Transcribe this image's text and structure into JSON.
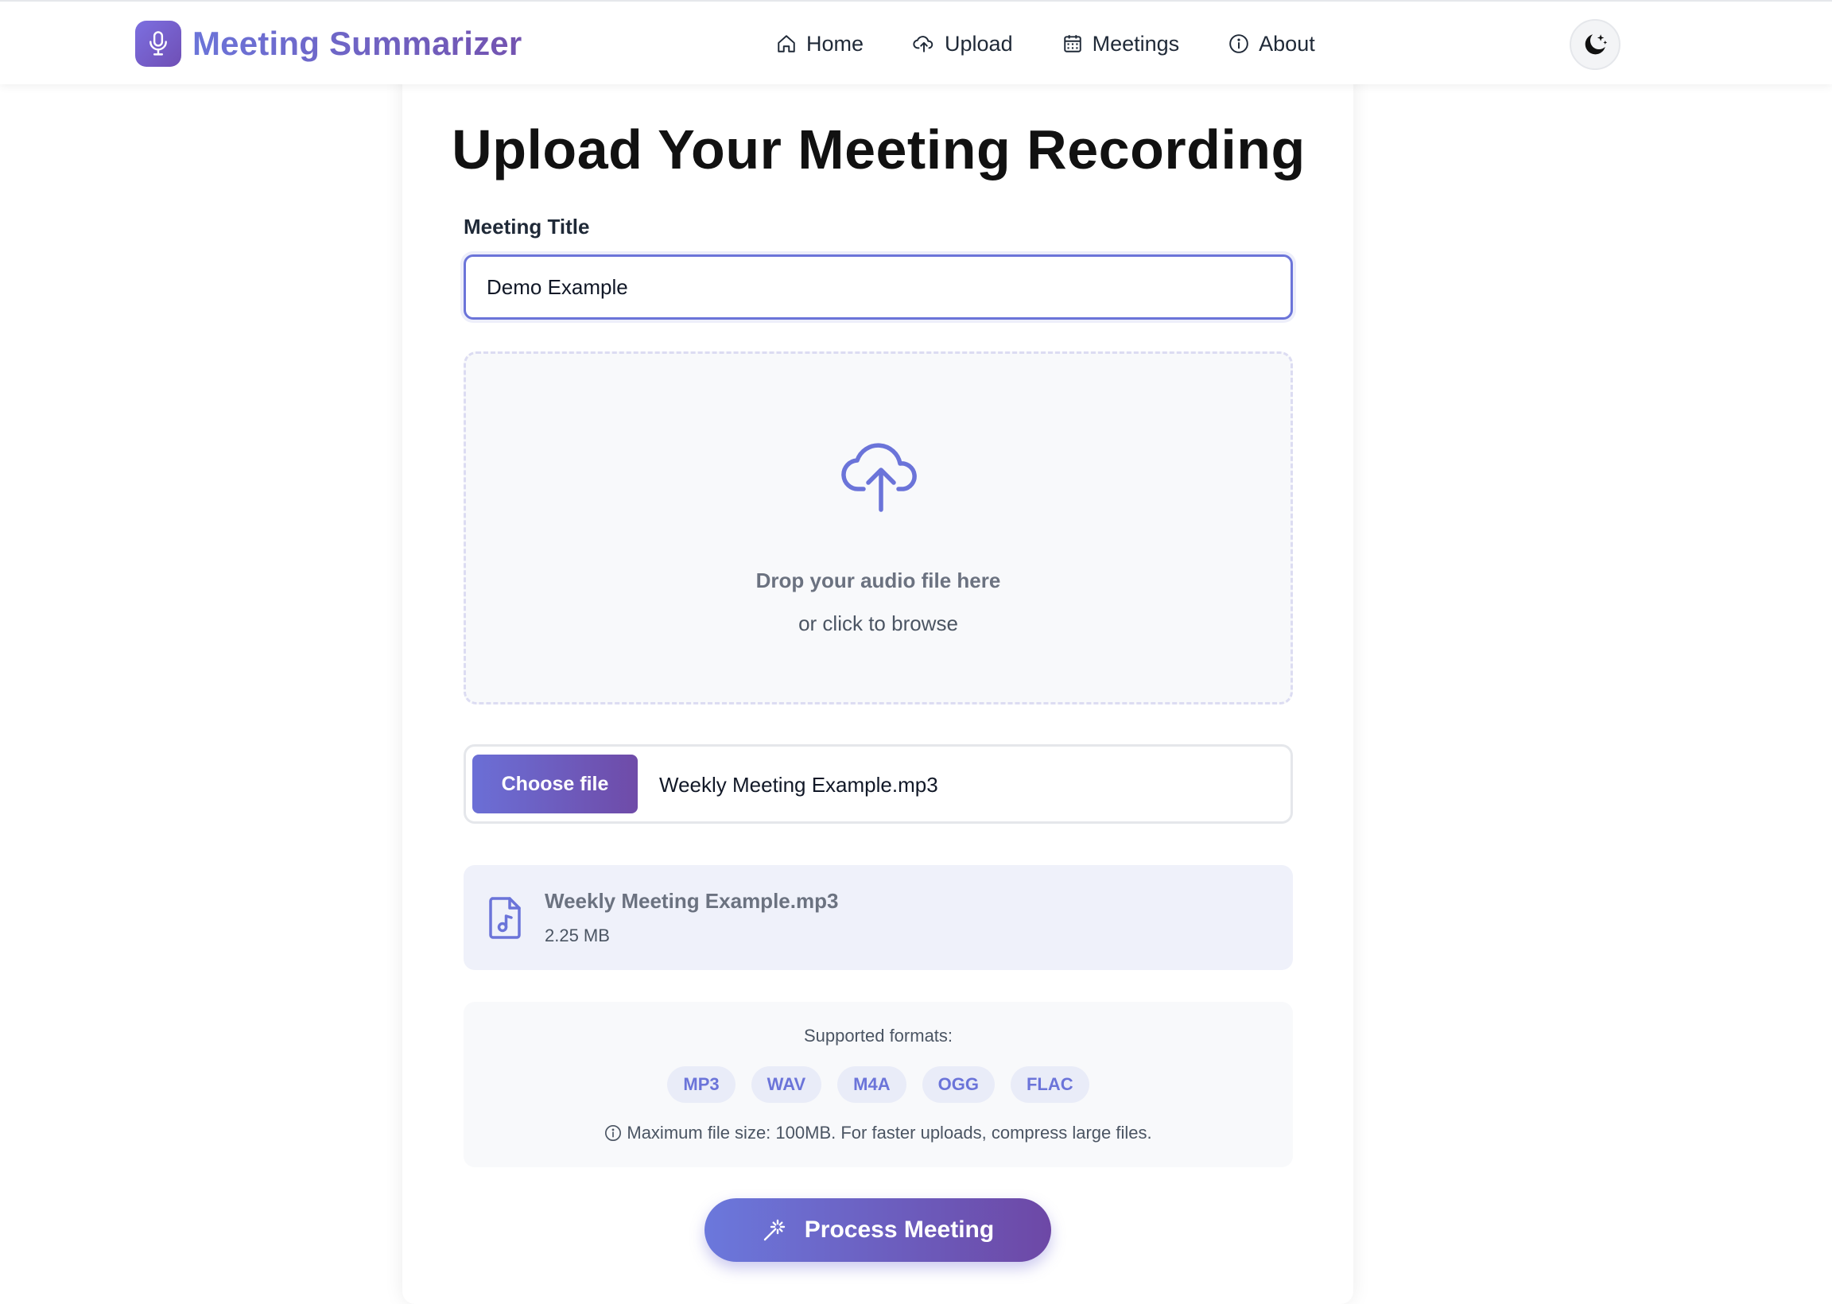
{
  "navbar": {
    "brand": "Meeting Summarizer",
    "links": [
      {
        "label": "Home",
        "icon": "home-icon"
      },
      {
        "label": "Upload",
        "icon": "cloud-upload-icon"
      },
      {
        "label": "Meetings",
        "icon": "calendar-icon"
      },
      {
        "label": "About",
        "icon": "info-icon"
      }
    ],
    "theme_toggle_icon": "moon-stars-icon"
  },
  "upload": {
    "title": "Upload Your Meeting Recording",
    "field_label": "Meeting Title",
    "title_value": "Demo Example",
    "dropzone": {
      "main_text": "Drop your audio file here",
      "sub_text": "or click to browse"
    },
    "file_input": {
      "button_label": "Choose file",
      "chosen_file": "Weekly Meeting Example.mp3"
    },
    "selected_file": {
      "name": "Weekly Meeting Example.mp3",
      "size": "2.25 MB"
    },
    "formats": {
      "title": "Supported formats:",
      "list": [
        "MP3",
        "WAV",
        "M4A",
        "OGG",
        "FLAC"
      ],
      "note": "Maximum file size: 100MB. For faster uploads, compress large files."
    },
    "process_label": "Process Meeting"
  },
  "colors": {
    "accent": "#6b74d9",
    "accent_dark": "#6f4ba8",
    "text": "#111827",
    "muted": "#6b7280"
  }
}
